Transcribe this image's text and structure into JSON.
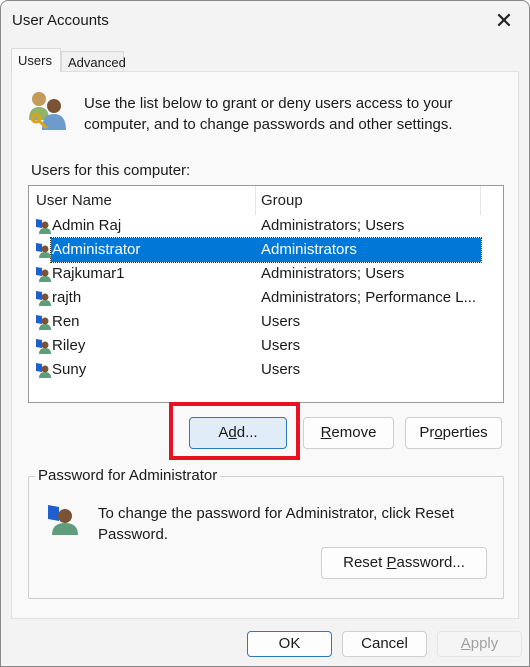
{
  "window": {
    "title": "User Accounts"
  },
  "tabs": [
    {
      "label": "Users",
      "active": true
    },
    {
      "label": "Advanced",
      "active": false
    }
  ],
  "intro": {
    "line1": "Use the list below to grant or deny users access to your",
    "line2": "computer, and to change passwords and other settings."
  },
  "list": {
    "label": "Users for this computer:",
    "columns": [
      "User Name",
      "Group"
    ],
    "rows": [
      {
        "name": "Admin Raj",
        "group": "Administrators; Users"
      },
      {
        "name": "Administrator",
        "group": "Administrators",
        "selected": true
      },
      {
        "name": "Rajkumar1",
        "group": "Administrators; Users"
      },
      {
        "name": "rajth",
        "group": "Administrators; Performance L..."
      },
      {
        "name": "Ren",
        "group": "Users"
      },
      {
        "name": "Riley",
        "group": "Users"
      },
      {
        "name": "Suny",
        "group": "Users"
      }
    ]
  },
  "buttons": {
    "add_pre": "A",
    "add_u": "d",
    "add_post": "d...",
    "remove_u": "R",
    "remove_post": "emove",
    "prop_pre": "Pr",
    "prop_u": "o",
    "prop_post": "perties"
  },
  "password": {
    "legend": "Password for Administrator",
    "line1": "To change the password for Administrator, click Reset",
    "line2": "Password.",
    "reset_pre": "Reset ",
    "reset_u": "P",
    "reset_post": "assword..."
  },
  "footer": {
    "ok": "OK",
    "cancel": "Cancel",
    "apply_u": "A",
    "apply_post": "pply"
  },
  "colors": {
    "selection": "#0078d7",
    "highlight_box": "#e81123"
  }
}
